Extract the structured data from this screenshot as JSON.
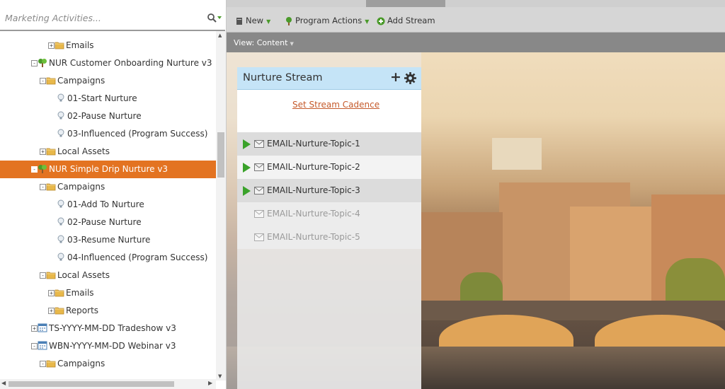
{
  "search": {
    "placeholder": "Marketing Activities..."
  },
  "tree": [
    {
      "label": "Emails",
      "icon": "folder",
      "toggle": "+",
      "indent": 3
    },
    {
      "label": "NUR Customer Onboarding Nurture v3",
      "icon": "nurture-program",
      "toggle": "-",
      "indent": 1
    },
    {
      "label": "Campaigns",
      "icon": "folder",
      "toggle": "-",
      "indent": 2
    },
    {
      "label": "01-Start Nurture",
      "icon": "campaign",
      "toggle": "",
      "indent": 3
    },
    {
      "label": "02-Pause Nurture",
      "icon": "campaign",
      "toggle": "",
      "indent": 3
    },
    {
      "label": "03-Influenced (Program Success)",
      "icon": "campaign",
      "toggle": "",
      "indent": 3
    },
    {
      "label": "Local Assets",
      "icon": "folder",
      "toggle": "+",
      "indent": 2
    },
    {
      "label": "NUR Simple Drip Nurture v3",
      "icon": "nurture-program",
      "toggle": "-",
      "indent": 1,
      "selected": true
    },
    {
      "label": "Campaigns",
      "icon": "folder",
      "toggle": "-",
      "indent": 2
    },
    {
      "label": "01-Add To Nurture",
      "icon": "campaign",
      "toggle": "",
      "indent": 3
    },
    {
      "label": "02-Pause Nurture",
      "icon": "campaign",
      "toggle": "",
      "indent": 3
    },
    {
      "label": "03-Resume Nurture",
      "icon": "campaign",
      "toggle": "",
      "indent": 3
    },
    {
      "label": "04-Influenced (Program Success)",
      "icon": "campaign",
      "toggle": "",
      "indent": 3
    },
    {
      "label": "Local Assets",
      "icon": "folder",
      "toggle": "-",
      "indent": 2
    },
    {
      "label": "Emails",
      "icon": "folder",
      "toggle": "+",
      "indent": 3
    },
    {
      "label": "Reports",
      "icon": "folder",
      "toggle": "+",
      "indent": 3
    },
    {
      "label": "TS-YYYY-MM-DD Tradeshow v3",
      "icon": "event-program",
      "toggle": "+",
      "indent": 1
    },
    {
      "label": "WBN-YYYY-MM-DD Webinar v3",
      "icon": "event-program",
      "toggle": "-",
      "indent": 1
    },
    {
      "label": "Campaigns",
      "icon": "folder",
      "toggle": "-",
      "indent": 2
    }
  ],
  "toolbar": {
    "new": "New",
    "program_actions": "Program Actions",
    "add_stream": "Add Stream"
  },
  "view": {
    "label": "View: Content"
  },
  "stream": {
    "title": "Nurture Stream",
    "cadence_link": "Set Stream Cadence",
    "items": [
      {
        "label": "EMAIL-Nurture-Topic-1",
        "active": true
      },
      {
        "label": "EMAIL-Nurture-Topic-2",
        "active": true
      },
      {
        "label": "EMAIL-Nurture-Topic-3",
        "active": true
      },
      {
        "label": "EMAIL-Nurture-Topic-4",
        "active": false
      },
      {
        "label": "EMAIL-Nurture-Topic-5",
        "active": false
      }
    ]
  },
  "colors": {
    "selected": "#e37321",
    "stream_header": "#c5e4f7",
    "link": "#c55a2b",
    "play": "#3aa22a"
  }
}
